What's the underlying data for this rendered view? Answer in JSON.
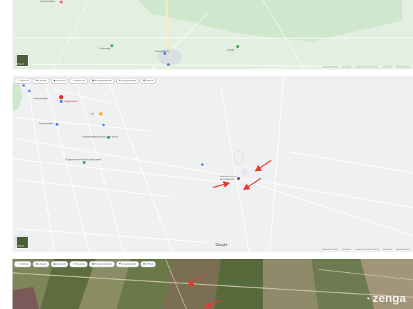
{
  "top_map": {
    "labels": [
      "Szabadszállás",
      "Kiskunsági",
      "Szabadság tér",
      "Csárda"
    ],
    "layers_label": "Rétegek",
    "footer_items": [
      "Térképadatok ©2025",
      "Adatvédelem",
      "Általános Szerződési Feltételek",
      "Visszajelzés",
      "Billentyűparancsok"
    ]
  },
  "mid_map": {
    "chips": [
      {
        "icon": "restaurant-icon",
        "label": "Éttermek"
      },
      {
        "icon": "hotel-icon",
        "label": "Hotelek"
      },
      {
        "icon": "attractions-icon",
        "label": "Látnivalók"
      },
      {
        "icon": "museum-icon",
        "label": "Múzeumok"
      },
      {
        "icon": "transit-icon",
        "label": "Tömegközlekedés"
      },
      {
        "icon": "pharmacy-icon",
        "label": "Gyógyszertárak"
      },
      {
        "icon": "atm-icon",
        "label": "ATM-ek"
      }
    ],
    "labels": {
      "poi_1": "Szabadszállás",
      "poi_red": "Polgármesteri",
      "poi_yellow": "Lidl",
      "poi_center": "Szabadszállási Kossuth Lajos Iskola",
      "poi_church": "Polgármesteri Hivatal Szabadszállás",
      "poi_school": "Szabadszállás",
      "target": "Kiskunsági Nemzeti Park Madárvárta"
    },
    "google_label": "Google",
    "layers_label": "Rétegek",
    "footer_items": [
      "Térképadatok ©2025",
      "Adatvédelem",
      "Általános Szerződési Feltételek",
      "Visszajelzés",
      "Billentyűparancsok"
    ]
  },
  "bottom_map": {
    "chips": [
      {
        "icon": "restaurant-icon",
        "label": "Éttermek"
      },
      {
        "icon": "hotel-icon",
        "label": "Hotelek"
      },
      {
        "icon": "attractions-icon",
        "label": "Látnivalók"
      },
      {
        "icon": "museum-icon",
        "label": "Múzeumok"
      },
      {
        "icon": "transit-icon",
        "label": "Tömegközlekedés"
      },
      {
        "icon": "pharmacy-icon",
        "label": "Gyógyszertárak"
      },
      {
        "icon": "atm-icon",
        "label": "ATM-ek"
      }
    ],
    "watermark": "zenga"
  },
  "colors": {
    "arrow": "#e53935",
    "road": "#ffffff",
    "green_area": "#cfe8cd"
  }
}
